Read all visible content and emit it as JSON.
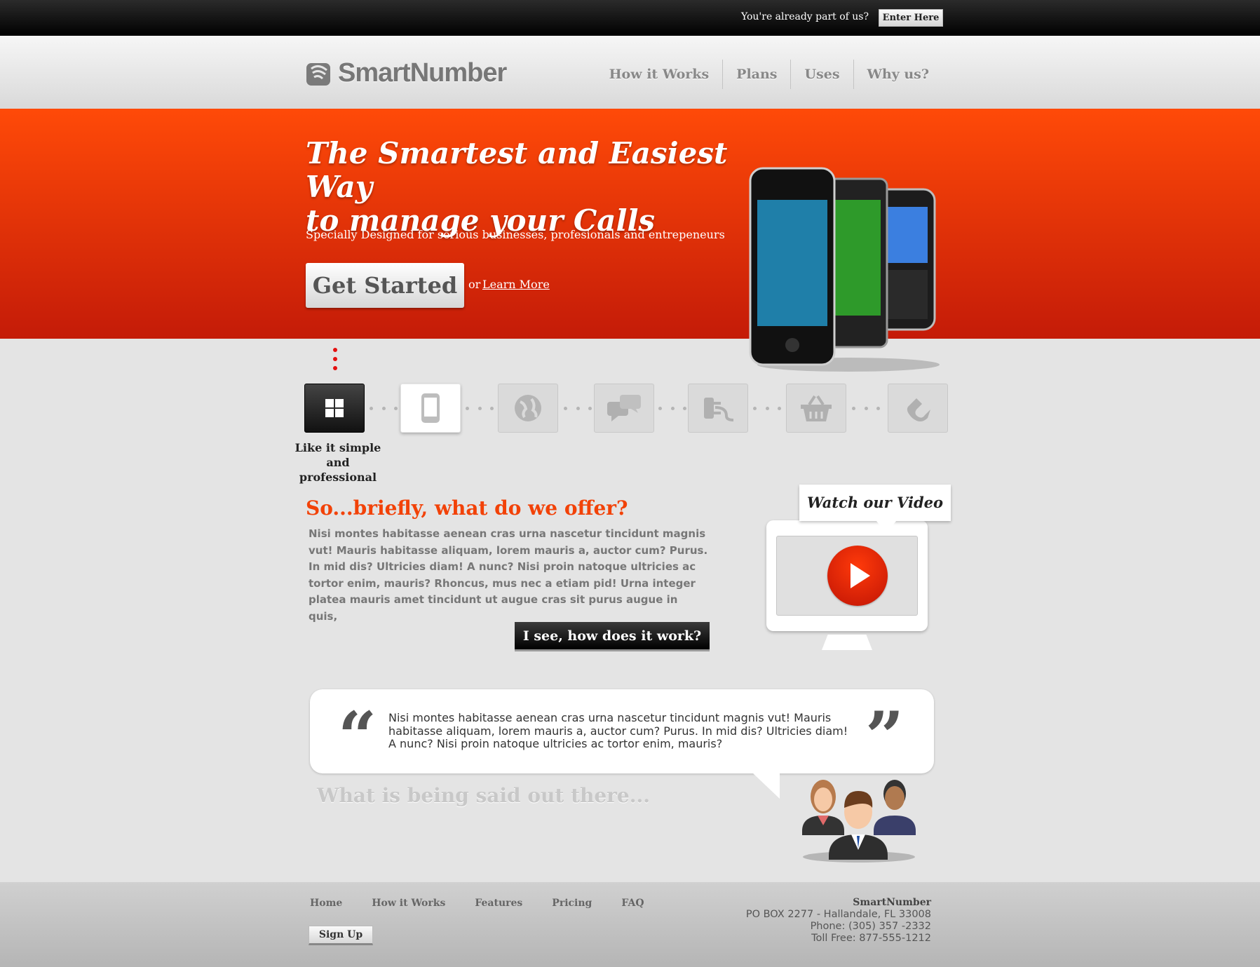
{
  "topbar": {
    "already_text": "You're already part of us?",
    "enter_label": "Enter Here"
  },
  "header": {
    "logo_text": "SmartNumber",
    "nav": [
      "How it Works",
      "Plans",
      "Uses",
      "Why us?"
    ]
  },
  "hero": {
    "headline_line1": "The Smartest and Easiest Way",
    "headline_line2": "to manage your Calls",
    "subtitle": "Specially Designed for serious businesses, profesionals and entrepeneurs",
    "cta_label": "Get Started",
    "or_text": "or",
    "learn_more": "Learn More"
  },
  "steps": {
    "icons": [
      "windows-icon",
      "phone-icon",
      "globe-icon",
      "chat-icon",
      "plug-icon",
      "basket-icon",
      "magnet-icon"
    ],
    "active_label_line1": "Like it simple",
    "active_label_line2": "and professional"
  },
  "offer": {
    "heading": "So...briefly, what do we offer?",
    "paragraph": "Nisi montes habitasse aenean cras urna nascetur tincidunt magnis vut! Mauris habitasse aliquam, lorem mauris a, auctor cum? Purus. In mid dis? Ultricies diam! A nunc? Nisi proin natoque ultricies ac tortor enim, mauris? Rhoncus, mus nec a etiam pid! Urna integer platea mauris amet tincidunt ut augue cras sit purus augue in quis,",
    "button_label": "I see, how does it work?"
  },
  "video": {
    "label": "Watch our Video"
  },
  "testimonial": {
    "open_quote": "“",
    "close_quote": "”",
    "text": "Nisi montes habitasse aenean cras urna nascetur tincidunt magnis vut! Mauris habitasse aliquam, lorem mauris a, auctor cum? Purus. In mid dis? Ultricies diam! A nunc? Nisi proin natoque ultricies ac tortor enim, mauris?",
    "heading": "What is being said out there..."
  },
  "footer": {
    "links": [
      "Home",
      "How it Works",
      "Features",
      "Pricing",
      "FAQ"
    ],
    "signup_label": "Sign Up",
    "company": "SmartNumber",
    "address": "PO BOX 2277 - Hallandale, FL 33008",
    "phone": "Phone: (305) 357 -2332",
    "tollfree": "Toll Free: 877-555-1212"
  },
  "colors": {
    "accent": "#f24208",
    "hero_top": "#ff4a08",
    "hero_bottom": "#c41b08"
  }
}
